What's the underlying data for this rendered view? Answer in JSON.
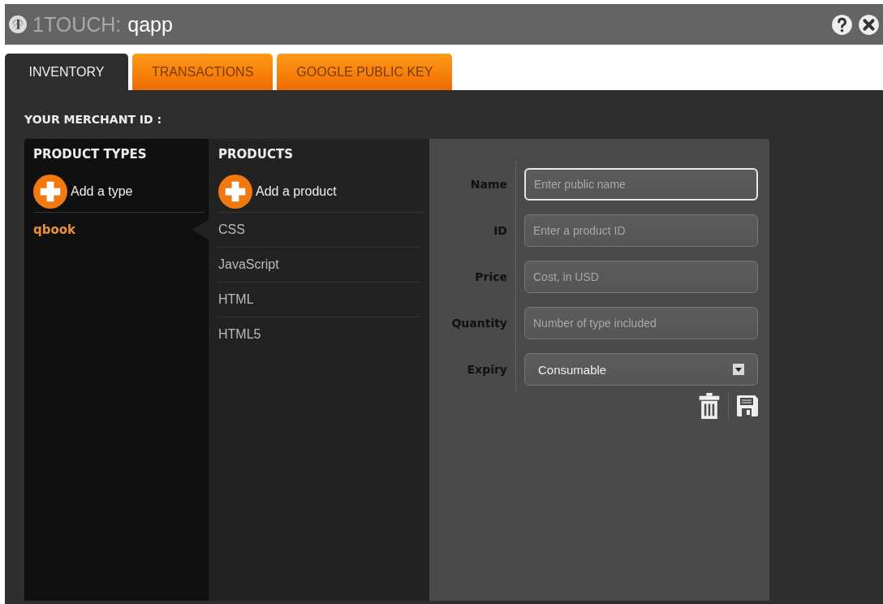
{
  "window": {
    "title_brand": "1TOUCH:",
    "title_app": "qapp"
  },
  "tabs": [
    {
      "label": "INVENTORY",
      "selected": true
    },
    {
      "label": "TRANSACTIONS",
      "selected": false
    },
    {
      "label": "GOOGLE PUBLIC KEY",
      "selected": false
    }
  ],
  "merchant_label": "YOUR MERCHANT ID :",
  "product_types": {
    "heading": "PRODUCT TYPES",
    "add_label": "Add a type",
    "items": [
      {
        "label": "qbook",
        "selected": true
      }
    ]
  },
  "products": {
    "heading": "PRODUCTS",
    "add_label": "Add a product",
    "items": [
      {
        "label": "CSS"
      },
      {
        "label": "JavaScript"
      },
      {
        "label": "HTML"
      },
      {
        "label": "HTML5"
      }
    ]
  },
  "form": {
    "fields": [
      {
        "label": "Name",
        "kind": "text",
        "placeholder": "Enter public name",
        "focused": true
      },
      {
        "label": "ID",
        "kind": "text",
        "placeholder": "Enter a product ID",
        "focused": false
      },
      {
        "label": "Price",
        "kind": "text",
        "placeholder": "Cost, in USD",
        "focused": false
      },
      {
        "label": "Quantity",
        "kind": "text",
        "placeholder": "Number of type included",
        "focused": false
      },
      {
        "label": "Expiry",
        "kind": "select",
        "value": "Consumable",
        "focused": false
      }
    ]
  }
}
